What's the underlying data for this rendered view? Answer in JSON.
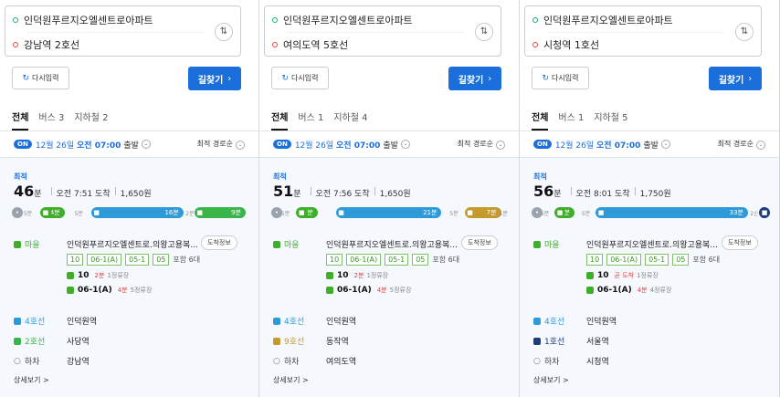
{
  "common": {
    "origin": "인덕원푸르지오엘센트로아파트",
    "swap_label": "⇅",
    "reset_label": "다시입력",
    "search_label": "길찾기",
    "search_arrow": "›",
    "on_badge": "ON",
    "date_prefix": "12월 26일",
    "date_time": "오전 07:00",
    "depart": "출발",
    "sort_label": "최적 경로순",
    "best_label": "최적",
    "minute_unit": "분",
    "detail_link": "상세보기 >",
    "colors": {
      "blue": "#1b6fdb",
      "green": "#3fae29",
      "line4": "#2e9bd8",
      "line2": "#39b54a",
      "line9": "#c49a2c",
      "line1": "#1d3c7a",
      "walk": "#bbbbbb"
    }
  },
  "panels": [
    {
      "destination": "강남역 2호선",
      "tabs": [
        "전체",
        "버스 3",
        "지하철 2"
      ],
      "minutes": "46",
      "arrive": "오전 7:51 도착",
      "fare": "1,650원",
      "segments": [
        {
          "kind": "walk",
          "label": "5분",
          "minutes": 5
        },
        {
          "kind": "bus",
          "label": "4분",
          "minutes": 4
        },
        {
          "kind": "walk",
          "label": "5분",
          "minutes": 5
        },
        {
          "kind": "line4",
          "label": "16분",
          "minutes": 16
        },
        {
          "kind": "walk",
          "label": "2분",
          "minutes": 2
        },
        {
          "kind": "line2",
          "label": "9분",
          "minutes": 9
        }
      ],
      "first_stop": "인덕원푸르지오엘센트로.의왕고용복...",
      "arrival_info": "도착정보",
      "bus_chips": [
        "10",
        "06-1(A)",
        "05-1",
        "05"
      ],
      "extra": "포함 6대",
      "bus_times": [
        {
          "bus": "10",
          "when": "2분",
          "stops": "1정류장"
        },
        {
          "bus": "06-1(A)",
          "when": "4분",
          "stops": "5정류장"
        }
      ],
      "legs": [
        {
          "mode": "마을",
          "stop": "",
          "kind": "bus"
        },
        {
          "mode": "4호선",
          "stop": "인덕원역",
          "kind": "line4"
        },
        {
          "mode": "2호선",
          "stop": "사당역",
          "kind": "line2"
        },
        {
          "mode": "하차",
          "stop": "강남역",
          "kind": "end"
        }
      ]
    },
    {
      "destination": "여의도역 5호선",
      "tabs": [
        "전체",
        "버스 1",
        "지하철 4"
      ],
      "minutes": "51",
      "arrive": "오전 7:56 도착",
      "fare": "1,650원",
      "segments": [
        {
          "kind": "walk",
          "label": "5분",
          "minutes": 5
        },
        {
          "kind": "bus",
          "label": "4분",
          "minutes": 4
        },
        {
          "kind": "walk",
          "label": "",
          "minutes": 4
        },
        {
          "kind": "line4",
          "label": "21분",
          "minutes": 21
        },
        {
          "kind": "walk",
          "label": "5분",
          "minutes": 5
        },
        {
          "kind": "line9",
          "label": "7분",
          "minutes": 7
        },
        {
          "kind": "walk",
          "label": "1분",
          "minutes": 1
        }
      ],
      "first_stop": "인덕원푸르지오엘센트로.의왕고용복...",
      "arrival_info": "도착정보",
      "bus_chips": [
        "10",
        "06-1(A)",
        "05-1",
        "05"
      ],
      "extra": "포함 6대",
      "bus_times": [
        {
          "bus": "10",
          "when": "2분",
          "stops": "1정류장"
        },
        {
          "bus": "06-1(A)",
          "when": "4분",
          "stops": "5정류장"
        }
      ],
      "legs": [
        {
          "mode": "마을",
          "stop": "",
          "kind": "bus"
        },
        {
          "mode": "4호선",
          "stop": "인덕원역",
          "kind": "line4"
        },
        {
          "mode": "9호선",
          "stop": "동작역",
          "kind": "line9"
        },
        {
          "mode": "하차",
          "stop": "여의도역",
          "kind": "end"
        }
      ]
    },
    {
      "destination": "시청역 1호선",
      "tabs": [
        "전체",
        "버스 1",
        "지하철 5"
      ],
      "minutes": "56",
      "arrive": "오전 8:01 도착",
      "fare": "1,750원",
      "segments": [
        {
          "kind": "walk",
          "label": "5분",
          "minutes": 5
        },
        {
          "kind": "bus",
          "label": "4분",
          "minutes": 4
        },
        {
          "kind": "walk",
          "label": "5분",
          "minutes": 5
        },
        {
          "kind": "line4",
          "label": "33분",
          "minutes": 33
        },
        {
          "kind": "walk",
          "label": "2분",
          "minutes": 2
        },
        {
          "kind": "line1",
          "label": "2분",
          "minutes": 2
        }
      ],
      "first_stop": "인덕원푸르지오엘센트로.의왕고용복...",
      "arrival_info": "도착정보",
      "bus_chips": [
        "10",
        "06-1(A)",
        "05-1",
        "05"
      ],
      "extra": "포함 6대",
      "bus_times": [
        {
          "bus": "10",
          "when": "곧 도착",
          "stops": "1정류장"
        },
        {
          "bus": "06-1(A)",
          "when": "4분",
          "stops": "4정류장"
        }
      ],
      "legs": [
        {
          "mode": "마을",
          "stop": "",
          "kind": "bus"
        },
        {
          "mode": "4호선",
          "stop": "인덕원역",
          "kind": "line4"
        },
        {
          "mode": "1호선",
          "stop": "서울역",
          "kind": "line1"
        },
        {
          "mode": "하차",
          "stop": "시청역",
          "kind": "end"
        }
      ]
    }
  ]
}
